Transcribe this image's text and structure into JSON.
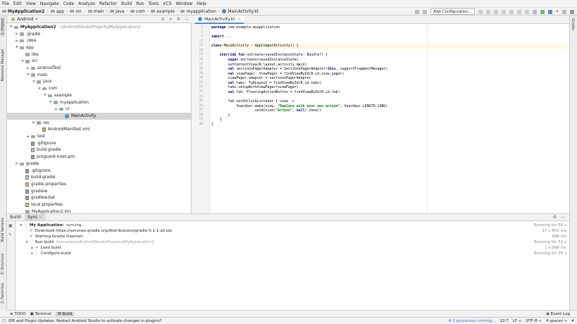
{
  "menu": [
    "File",
    "Edit",
    "View",
    "Navigate",
    "Code",
    "Analyze",
    "Refactor",
    "Build",
    "Run",
    "Tools",
    "VCS",
    "Window",
    "Help"
  ],
  "breadcrumb": [
    "MyApplication2",
    "app",
    "src",
    "main",
    "java",
    "com",
    "example",
    "myapplication",
    "MainActivity.kt"
  ],
  "toolbar": {
    "add_config": "Add Configuration..."
  },
  "left_stripe": {
    "project": "1: Project",
    "resource_manager": "Resource Manager",
    "build_variants": "Build Variants",
    "structure": "Z: Structure",
    "favorites": "2: Favorites"
  },
  "right_stripe": {
    "gradle": "Gradle"
  },
  "project": {
    "view_selector": "Android",
    "tree": [
      {
        "label": "MyApplication2",
        "path": "~/AndroidStudioProjects/MyApplication2",
        "depth": 0,
        "expanded": true,
        "type": "module"
      },
      {
        "label": ".gradle",
        "depth": 1,
        "type": "folder",
        "collapsed": true
      },
      {
        "label": ".idea",
        "depth": 1,
        "type": "folder",
        "collapsed": true
      },
      {
        "label": "app",
        "depth": 1,
        "type": "folder",
        "expanded": true
      },
      {
        "label": "libs",
        "depth": 2,
        "type": "folder"
      },
      {
        "label": "src",
        "depth": 2,
        "type": "folder",
        "expanded": true
      },
      {
        "label": "androidTest",
        "depth": 3,
        "type": "folder",
        "collapsed": true
      },
      {
        "label": "main",
        "depth": 3,
        "type": "folder",
        "expanded": true
      },
      {
        "label": "java",
        "depth": 4,
        "type": "folder",
        "expanded": true
      },
      {
        "label": "com",
        "depth": 5,
        "type": "folder",
        "expanded": true
      },
      {
        "label": "example",
        "depth": 6,
        "type": "folder",
        "expanded": true
      },
      {
        "label": "myapplication",
        "depth": 7,
        "type": "folder",
        "expanded": true
      },
      {
        "label": "ui",
        "depth": 8,
        "type": "folder",
        "collapsed": true
      },
      {
        "label": "MainActivity",
        "depth": 9,
        "type": "kotlin",
        "selected": true
      },
      {
        "label": "res",
        "depth": 4,
        "type": "folder",
        "collapsed": true
      },
      {
        "label": "AndroidManifest.xml",
        "depth": 5,
        "type": "xml"
      },
      {
        "label": "test",
        "depth": 3,
        "type": "folder",
        "collapsed": true
      },
      {
        "label": ".gitignore",
        "depth": 3,
        "type": "file"
      },
      {
        "label": "build.gradle",
        "depth": 3,
        "type": "gradle"
      },
      {
        "label": "proguard-rules.pro",
        "depth": 3,
        "type": "file"
      },
      {
        "label": "gradle",
        "depth": 1,
        "type": "folder",
        "collapsed": true
      },
      {
        "label": ".gitignore",
        "depth": 2,
        "type": "file"
      },
      {
        "label": "build.gradle",
        "depth": 2,
        "type": "gradle"
      },
      {
        "label": "gradle.properties",
        "depth": 2,
        "type": "props"
      },
      {
        "label": "gradlew",
        "depth": 2,
        "type": "file"
      },
      {
        "label": "gradlew.bat",
        "depth": 2,
        "type": "file"
      },
      {
        "label": "local.properties",
        "depth": 2,
        "type": "props"
      },
      {
        "label": "MyApplication2.iml",
        "depth": 2,
        "type": "iml"
      }
    ]
  },
  "editor": {
    "tab": "MainActivity.kt",
    "current_line": "13",
    "lines": [
      {
        "n": "1",
        "code": "<k>package</k> com.example.myapplication"
      },
      {
        "n": "2",
        "code": ""
      },
      {
        "n": "3",
        "code": "<k>import</k> ..."
      },
      {
        "n": "12",
        "code": ""
      },
      {
        "n": "13",
        "code": "<k>class</k> MainActivity : AppCompatActivity() {"
      },
      {
        "n": "14",
        "code": ""
      },
      {
        "n": "15",
        "code": "    <k>override fun</k> onCreate(savedInstanceState: Bundle?) {"
      },
      {
        "n": "16",
        "code": "        <k>super</k>.onCreate(savedInstanceState)"
      },
      {
        "n": "17",
        "code": "        setContentView(R.layout.activity_main)"
      },
      {
        "n": "18",
        "code": "        <k>val</k> sectionsPagerAdapter = SectionsPagerAdapter(<k>this</k>, supportFragmentManager)"
      },
      {
        "n": "19",
        "code": "        <k>val</k> viewPager: ViewPager = findViewById(R.id.view_pager)"
      },
      {
        "n": "20",
        "code": "        viewPager.adapter = sectionsPagerAdapter"
      },
      {
        "n": "21",
        "code": "        <k>val</k> tabs: TabLayout = findViewById(R.id.tabs)"
      },
      {
        "n": "22",
        "code": "        tabs.setupWithViewPager(viewPager)"
      },
      {
        "n": "23",
        "code": "        <k>val</k> fab: FloatingActionButton = findViewById(R.id.fab)"
      },
      {
        "n": "24",
        "code": ""
      },
      {
        "n": "25",
        "code": "        fab.setOnClickListener { view ->"
      },
      {
        "n": "26",
        "code": "            Snackbar.make(view, <s>\"Replace with your own action\"</s>, Snackbar.LENGTH_LONG)"
      },
      {
        "n": "27",
        "code": "                    .setAction(<s>\"Action\"</s>, <k>null</k>).show()"
      },
      {
        "n": "28",
        "code": "        }"
      },
      {
        "n": "29",
        "code": "    }"
      },
      {
        "n": "30",
        "code": "}"
      }
    ]
  },
  "build": {
    "label": "Build:",
    "tab": "Sync",
    "rows": [
      {
        "text": "My Application:",
        "suffix": "syncing...",
        "status": "running",
        "depth": 0,
        "time": "Running for 56 s",
        "arrow": "▼"
      },
      {
        "text": "Download https://services.gradle.org/distributions/gradle-5.1.1-all.zip",
        "status": "done",
        "depth": 1,
        "time": "17 s 843 ms",
        "arrow": ""
      },
      {
        "text": "Starting Gradle Daemon",
        "status": "done",
        "depth": 1,
        "time": "988 ms",
        "arrow": ""
      },
      {
        "text": "Run build",
        "suffix": "/home/alan/AndroidStudioProjects/MyApplication2",
        "status": "running",
        "depth": 1,
        "time": "Running for 32 s",
        "arrow": "▼"
      },
      {
        "text": "Load build",
        "status": "done",
        "depth": 2,
        "time": "1 s 999 ms",
        "arrow": "▶"
      },
      {
        "text": "Configure build",
        "status": "running",
        "depth": 2,
        "time": "Running for 26 s",
        "arrow": "▶"
      }
    ]
  },
  "bottom_tabs": {
    "todo": "TODO",
    "terminal": "Terminal",
    "build": "Build",
    "event_log": "Event Log"
  },
  "status": {
    "message": "IDE and Plugin Updates: Restart Android Studio to activate changes in plugins?",
    "processes": "2 processes running...",
    "position": "13:7",
    "line_sep": "LF",
    "encoding": "UTF-8",
    "indent": "4 spaces"
  }
}
